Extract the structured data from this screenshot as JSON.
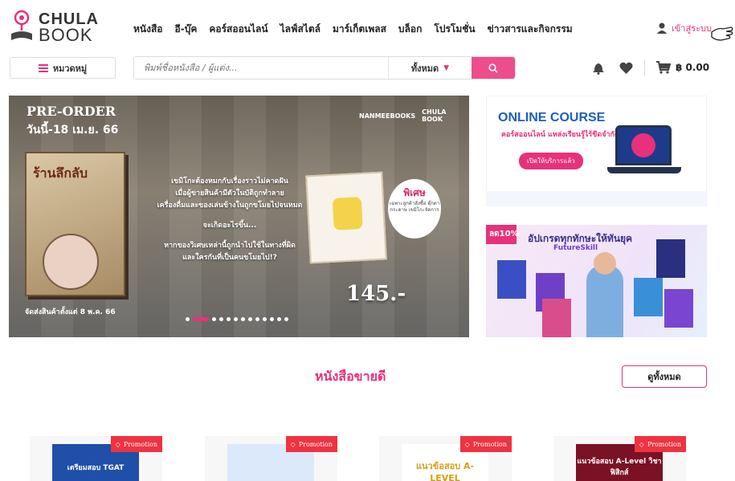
{
  "header": {
    "logo_line1": "CHULA",
    "logo_line2": "BOOK",
    "nav": [
      "หนังสือ",
      "อี-บุ๊ค",
      "คอร์สออนไลน์",
      "ไลฟ์สไตล์",
      "มาร์เก็ตเพลส",
      "บล็อก",
      "โปรโมชั่น",
      "ข่าวสารและกิจกรรม"
    ],
    "login_label": "เข้าสู่ระบบ"
  },
  "searchbar": {
    "category_label": "หมวดหมู่",
    "placeholder": "พิมพ์ชื่อหนังสือ / ผู้แต่ง...",
    "scope_label": "ทั้งหมด",
    "cart_amount": "฿ 0.00"
  },
  "hero": {
    "preorder": "PRE-ORDER",
    "until": "วันนี้-18 เม.ย. 66",
    "brand1": "NANMEEBOOKS",
    "brand2": "CHULA BOOK",
    "book_title": "ร้านลึกลับ",
    "blurb1": "เขมิโกะต้องหมกกับเรื่องราวไม่คาดฝัน",
    "blurb2": "เมื่อผู้ขายสินค้ามีตัวในบัติถูกทำลาย",
    "blurb3": "เครื่องดื่มและของเล่นข้างในถูกขโมยไปจนหมด",
    "blurb4": "จะเกิดอะไรขึ้น...",
    "blurb5": "หากของวิเศษเหล่านี้ถูกนำไปใช้ในทางที่ผิด",
    "blurb6": "และใครกันที่เป็นคนขโมยไป!?",
    "special": "พิเศษ",
    "special_sub": "เฉพาะลูกค้าสั่งซื้อ ตุ๊กตากระดาษ เขมิโกะจัดการ",
    "price": "145.-",
    "ship": "จัดส่งสินค้าตั้งแต่ 8 พ.ค. 66",
    "dots_total": 13,
    "dots_active": 1
  },
  "banner_course": {
    "title": "ONLINE COURSE",
    "subtitle": "คอร์สออนไลน์ แหล่งเรียนรู้ไร้ขีดจำกัด",
    "button": "เปิดให้บริการแล้ว"
  },
  "banner_skill": {
    "badge": "ลด10%",
    "title": "อัปเกรดทุกทักษะให้ทันยุค",
    "subtitle": "FutureSkill"
  },
  "bestsellers": {
    "title": "หนังสือขายดี",
    "view_all": "ดูทั้งหมด",
    "promo_label": "Promotion",
    "products": [
      {
        "cover_text": "เตรียมสอบ TGAT",
        "bg": "#1f4fa8"
      },
      {
        "cover_text": "",
        "bg": "#dbe9fb"
      },
      {
        "cover_text": "แนวข้อสอบ A-LEVEL",
        "bg": "#ffffff"
      },
      {
        "cover_text": "แนวข้อสอบ A-Level วิชาฟิสิกส์",
        "bg": "#7a1124"
      }
    ]
  },
  "colors": {
    "accent": "#e8317a",
    "promo": "#ef3340"
  }
}
